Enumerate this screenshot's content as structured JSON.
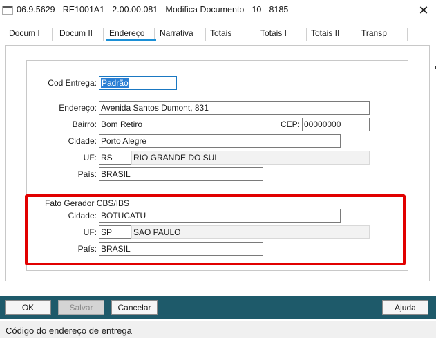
{
  "window": {
    "title": "06.9.5629 - RE1001A1 - 2.00.00.081 - Modifica Documento - 10 - 8185",
    "close_glyph": "✕"
  },
  "tabs": [
    {
      "label": "Docum I"
    },
    {
      "label": "Docum II"
    },
    {
      "label": "Endereço",
      "active": true
    },
    {
      "label": "Narrativa"
    },
    {
      "label": "Totais"
    },
    {
      "label": "Totais I"
    },
    {
      "label": "Totais II"
    },
    {
      "label": "Transp"
    }
  ],
  "form": {
    "cod_entrega_label": "Cod Entrega:",
    "cod_entrega_value": "Padrão",
    "endereco_label": "Endereço:",
    "endereco_value": "Avenida Santos Dumont, 831",
    "bairro_label": "Bairro:",
    "bairro_value": "Bom Retiro",
    "cep_label": "CEP:",
    "cep_value": "00000000",
    "cidade_label": "Cidade:",
    "cidade_value": "Porto Alegre",
    "uf_label": "UF:",
    "uf_value": "RS",
    "uf_name": "RIO GRANDE DO SUL",
    "pais_label": "País:",
    "pais_value": "BRASIL"
  },
  "fato_gerador": {
    "group_label": "Fato Gerador CBS/IBS",
    "cidade_label": "Cidade:",
    "cidade_value": "BOTUCATU",
    "uf_label": "UF:",
    "uf_value": "SP",
    "uf_name": "SAO PAULO",
    "pais_label": "País:",
    "pais_value": "BRASIL"
  },
  "buttons": {
    "ok": "OK",
    "salvar": "Salvar",
    "cancelar": "Cancelar",
    "ajuda": "Ajuda"
  },
  "status_text": "Código do endereço de entrega",
  "colors": {
    "accent": "#1a8fd6",
    "highlight": "#e10000",
    "button_bar": "#1e5a6a",
    "selection": "#2a7fd4"
  }
}
